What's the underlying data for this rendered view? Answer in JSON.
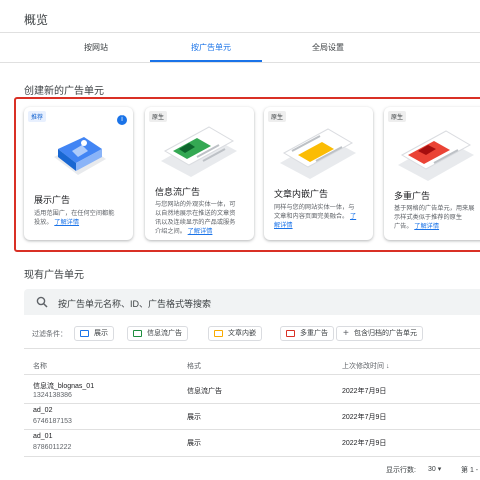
{
  "page": {
    "title": "概览"
  },
  "tabs": [
    {
      "label": "按网站"
    },
    {
      "label": "按广告单元"
    },
    {
      "label": "全局设置"
    }
  ],
  "create_section": {
    "title": "创建新的广告单元",
    "cards": [
      {
        "tag": "推荐",
        "badge": "i",
        "title": "展示广告",
        "desc_lines": [
          "适用范围广，在任何空间都能",
          "投放。"
        ],
        "link": "了解详情",
        "accent": "#4285f4"
      },
      {
        "tag": "原生",
        "title": "信息流广告",
        "desc_lines": [
          "与您网站的外观实体一体，可",
          "以自然地展示在推送的文章资",
          "讯以及连续显示的产品或服务",
          "介绍之间。"
        ],
        "link": "了解详情",
        "accent": "#34a853"
      },
      {
        "tag": "原生",
        "title": "文章内嵌广告",
        "desc_lines": [
          "同样与您的网站实体一体，与",
          "文章和内容页面完美融合。"
        ],
        "link_inline": "了",
        "link": "解详情",
        "accent": "#fbbc04"
      },
      {
        "tag": "原生",
        "title": "多重广告",
        "desc_lines": [
          "基于网格的广告单元，用来展",
          "示样式类似于推荐的原生",
          "广告。"
        ],
        "link": "了解详情",
        "accent": "#ea4335"
      }
    ]
  },
  "existing_section": {
    "title": "现有广告单元",
    "search_placeholder": "按广告单元名称、ID、广告格式等搜索",
    "filter_label": "过滤条件：",
    "chips": [
      {
        "label": "展示",
        "color": "#1a73e8"
      },
      {
        "label": "信息流广告",
        "color": "#1e8e3e"
      },
      {
        "label": "文章内嵌",
        "color": "#f9ab00"
      },
      {
        "label": "多重广告",
        "color": "#d93025"
      },
      {
        "label": "包含归档的广告单元",
        "add": "+"
      }
    ],
    "columns": [
      "名称",
      "格式",
      "上次修改时间 ↓"
    ],
    "rows": [
      {
        "name": "信息流_blognas_01",
        "id": "1324138386",
        "format": "信息流广告",
        "modified": "2022年7月9日"
      },
      {
        "name": "ad_02",
        "id": "6746187153",
        "format": "展示",
        "modified": "2022年7月9日"
      },
      {
        "name": "ad_01",
        "id": "8786011222",
        "format": "展示",
        "modified": "2022年7月9日"
      }
    ]
  },
  "footer": {
    "rows_per_page_label": "显示行数:",
    "rows_per_page_value": "30",
    "dropdown_icon": "▾",
    "page_label": "第 1 -"
  }
}
